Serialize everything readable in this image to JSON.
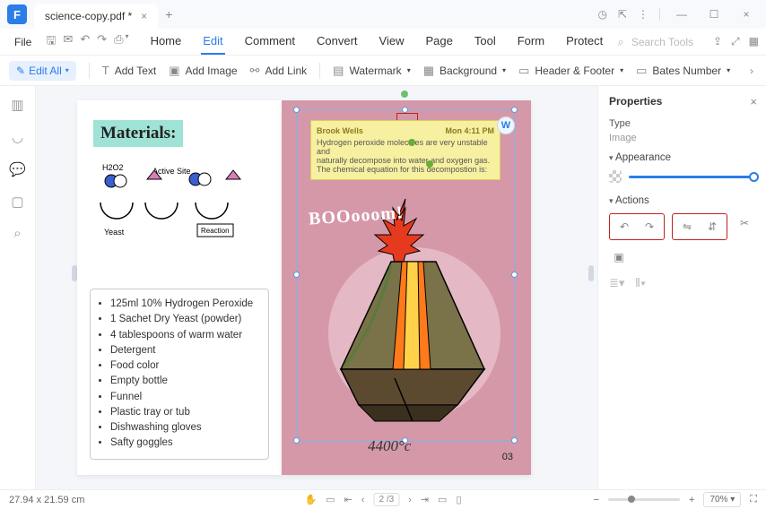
{
  "titlebar": {
    "app_letter": "F",
    "tab_name": "science-copy.pdf *"
  },
  "menubar": {
    "file": "File",
    "items": [
      "Home",
      "Edit",
      "Comment",
      "Convert",
      "View",
      "Page",
      "Tool",
      "Form",
      "Protect"
    ],
    "active_index": 1,
    "search_placeholder": "Search Tools"
  },
  "toolbar": {
    "editall": "Edit All",
    "addtext": "Add Text",
    "addimage": "Add Image",
    "addlink": "Add Link",
    "watermark": "Watermark",
    "background": "Background",
    "headerfooter": "Header & Footer",
    "bates": "Bates Number"
  },
  "document": {
    "materials_heading": "Materials:",
    "diagram_labels": {
      "h2o2": "H2O2",
      "active": "Active Site",
      "yeast": "Yeast",
      "reaction": "Reaction"
    },
    "materials_list": [
      "125ml 10% Hydrogen Peroxide",
      "1 Sachet Dry Yeast (powder)",
      "4 tablespoons of warm water",
      "Detergent",
      "Food color",
      "Empty bottle",
      "Funnel",
      "Plastic tray or tub",
      "Dishwashing gloves",
      "Safty goggles"
    ],
    "note": {
      "author": "Brook Wells",
      "time": "Mon 4:11 PM",
      "line1": "Hydrogen peroxide molecules are very unstable and",
      "line2": "naturally decompose into water and oxygen gas.",
      "line3": "The chemical equation for this decompostion is:"
    },
    "booom": "BOOooom!",
    "temp": "4400°c",
    "page_num": "03",
    "w_badge": "W"
  },
  "properties": {
    "title": "Properties",
    "type_lbl": "Type",
    "type_val": "Image",
    "appearance": "Appearance",
    "actions": "Actions"
  },
  "status": {
    "dims": "27.94 x 21.59 cm",
    "page_current": "2",
    "page_total": "/3",
    "zoom": "70%"
  }
}
